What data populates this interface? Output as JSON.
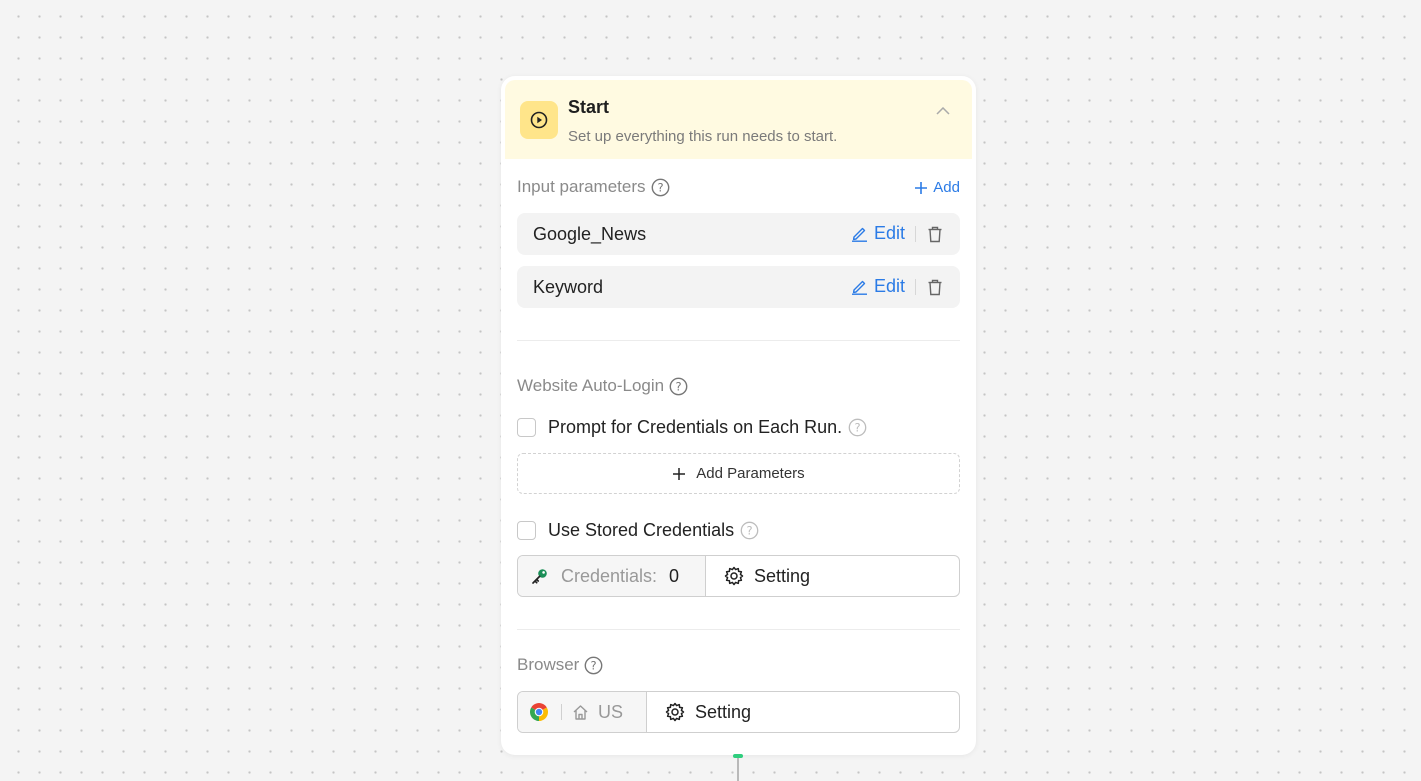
{
  "start": {
    "title": "Start",
    "subtitle": "Set up everything this run needs to start."
  },
  "input_parameters": {
    "title": "Input parameters",
    "add_label": "Add",
    "items": [
      {
        "name": "Google_News",
        "edit_label": "Edit"
      },
      {
        "name": "Keyword",
        "edit_label": "Edit"
      }
    ]
  },
  "auto_login": {
    "title": "Website Auto-Login",
    "prompt_label": "Prompt for Credentials on Each Run.",
    "add_params_label": "Add Parameters",
    "stored_label": "Use Stored Credentials",
    "credentials_label": "Credentials:",
    "credentials_count": "0",
    "setting_label": "Setting"
  },
  "browser": {
    "title": "Browser",
    "region": "US",
    "setting_label": "Setting"
  },
  "colors": {
    "accent": "#2b7be6",
    "header_bg": "#fffae1",
    "icon_bg": "#ffe58a",
    "connector": "#2fce7e"
  }
}
